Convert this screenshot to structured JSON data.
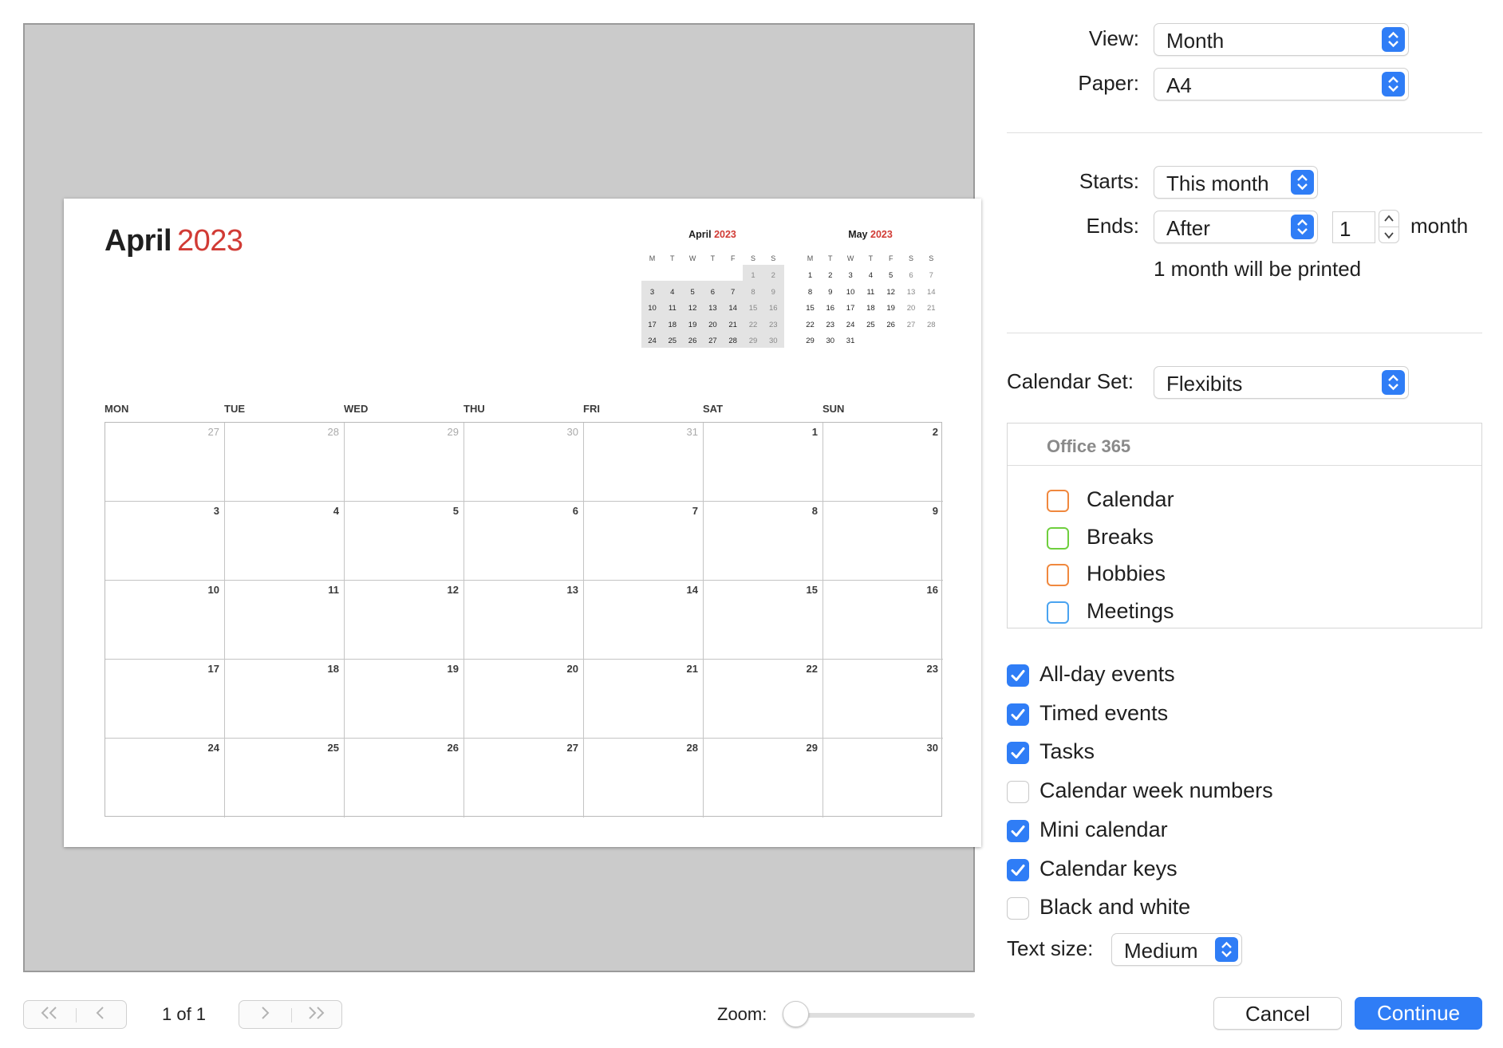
{
  "preview": {
    "month": "April",
    "year": "2023",
    "weekdays": [
      "MON",
      "TUE",
      "WED",
      "THU",
      "FRI",
      "SAT",
      "SUN"
    ],
    "weeks": [
      [
        {
          "d": "27",
          "out": true
        },
        {
          "d": "28",
          "out": true
        },
        {
          "d": "29",
          "out": true
        },
        {
          "d": "30",
          "out": true
        },
        {
          "d": "31",
          "out": true
        },
        {
          "d": "1",
          "out": false
        },
        {
          "d": "2",
          "out": false
        }
      ],
      [
        {
          "d": "3",
          "out": false
        },
        {
          "d": "4",
          "out": false
        },
        {
          "d": "5",
          "out": false
        },
        {
          "d": "6",
          "out": false
        },
        {
          "d": "7",
          "out": false
        },
        {
          "d": "8",
          "out": false
        },
        {
          "d": "9",
          "out": false
        }
      ],
      [
        {
          "d": "10",
          "out": false
        },
        {
          "d": "11",
          "out": false
        },
        {
          "d": "12",
          "out": false
        },
        {
          "d": "13",
          "out": false
        },
        {
          "d": "14",
          "out": false
        },
        {
          "d": "15",
          "out": false
        },
        {
          "d": "16",
          "out": false
        }
      ],
      [
        {
          "d": "17",
          "out": false
        },
        {
          "d": "18",
          "out": false
        },
        {
          "d": "19",
          "out": false
        },
        {
          "d": "20",
          "out": false
        },
        {
          "d": "21",
          "out": false
        },
        {
          "d": "22",
          "out": false
        },
        {
          "d": "23",
          "out": false
        }
      ],
      [
        {
          "d": "24",
          "out": false
        },
        {
          "d": "25",
          "out": false
        },
        {
          "d": "26",
          "out": false
        },
        {
          "d": "27",
          "out": false
        },
        {
          "d": "28",
          "out": false
        },
        {
          "d": "29",
          "out": false
        },
        {
          "d": "30",
          "out": false
        }
      ]
    ],
    "mini_calendars": [
      {
        "month": "April",
        "year": "2023",
        "weekdays": [
          "M",
          "T",
          "W",
          "T",
          "F",
          "S",
          "S"
        ],
        "highlighted": true,
        "weeks": [
          [
            "",
            "",
            "",
            "",
            "",
            "1",
            "2"
          ],
          [
            "3",
            "4",
            "5",
            "6",
            "7",
            "8",
            "9"
          ],
          [
            "10",
            "11",
            "12",
            "13",
            "14",
            "15",
            "16"
          ],
          [
            "17",
            "18",
            "19",
            "20",
            "21",
            "22",
            "23"
          ],
          [
            "24",
            "25",
            "26",
            "27",
            "28",
            "29",
            "30"
          ]
        ]
      },
      {
        "month": "May",
        "year": "2023",
        "weekdays": [
          "M",
          "T",
          "W",
          "T",
          "F",
          "S",
          "S"
        ],
        "highlighted": false,
        "weeks": [
          [
            "1",
            "2",
            "3",
            "4",
            "5",
            "6",
            "7"
          ],
          [
            "8",
            "9",
            "10",
            "11",
            "12",
            "13",
            "14"
          ],
          [
            "15",
            "16",
            "17",
            "18",
            "19",
            "20",
            "21"
          ],
          [
            "22",
            "23",
            "24",
            "25",
            "26",
            "27",
            "28"
          ],
          [
            "29",
            "30",
            "31",
            "",
            "",
            "",
            ""
          ]
        ]
      }
    ]
  },
  "pager": {
    "first_icon": "double-chevron-left-icon",
    "prev_icon": "chevron-left-icon",
    "next_icon": "chevron-right-icon",
    "last_icon": "double-chevron-right-icon",
    "page_count": "1 of 1"
  },
  "zoom": {
    "label": "Zoom:",
    "level": 0
  },
  "settings": {
    "view_label": "View:",
    "view_value": "Month",
    "paper_label": "Paper:",
    "paper_value": "A4",
    "starts_label": "Starts:",
    "starts_value": "This month",
    "ends_label": "Ends:",
    "ends_value": "After",
    "ends_count": "1",
    "ends_unit": "month",
    "summary": "1 month will be printed",
    "calendar_set_label": "Calendar Set:",
    "calendar_set_value": "Flexibits",
    "text_size_label": "Text size:",
    "text_size_value": "Medium"
  },
  "calendar_group": {
    "title": "Office 365",
    "calendars": [
      {
        "name": "Calendar",
        "color": "#f0883e",
        "checked": false
      },
      {
        "name": "Breaks",
        "color": "#6fcf3e",
        "checked": false
      },
      {
        "name": "Hobbies",
        "color": "#f0883e",
        "checked": false
      },
      {
        "name": "Meetings",
        "color": "#4aa3f0",
        "checked": false
      }
    ]
  },
  "options": [
    {
      "label": "All-day events",
      "checked": true
    },
    {
      "label": "Timed events",
      "checked": true
    },
    {
      "label": "Tasks",
      "checked": true
    },
    {
      "label": "Calendar week numbers",
      "checked": false
    },
    {
      "label": "Mini calendar",
      "checked": true
    },
    {
      "label": "Calendar keys",
      "checked": true
    },
    {
      "label": "Black and white",
      "checked": false
    }
  ],
  "buttons": {
    "cancel": "Cancel",
    "continue": "Continue"
  },
  "colors": {
    "accent": "#2f7df6",
    "year_red": "#d13b35",
    "preview_bg": "#cbcbcb"
  }
}
